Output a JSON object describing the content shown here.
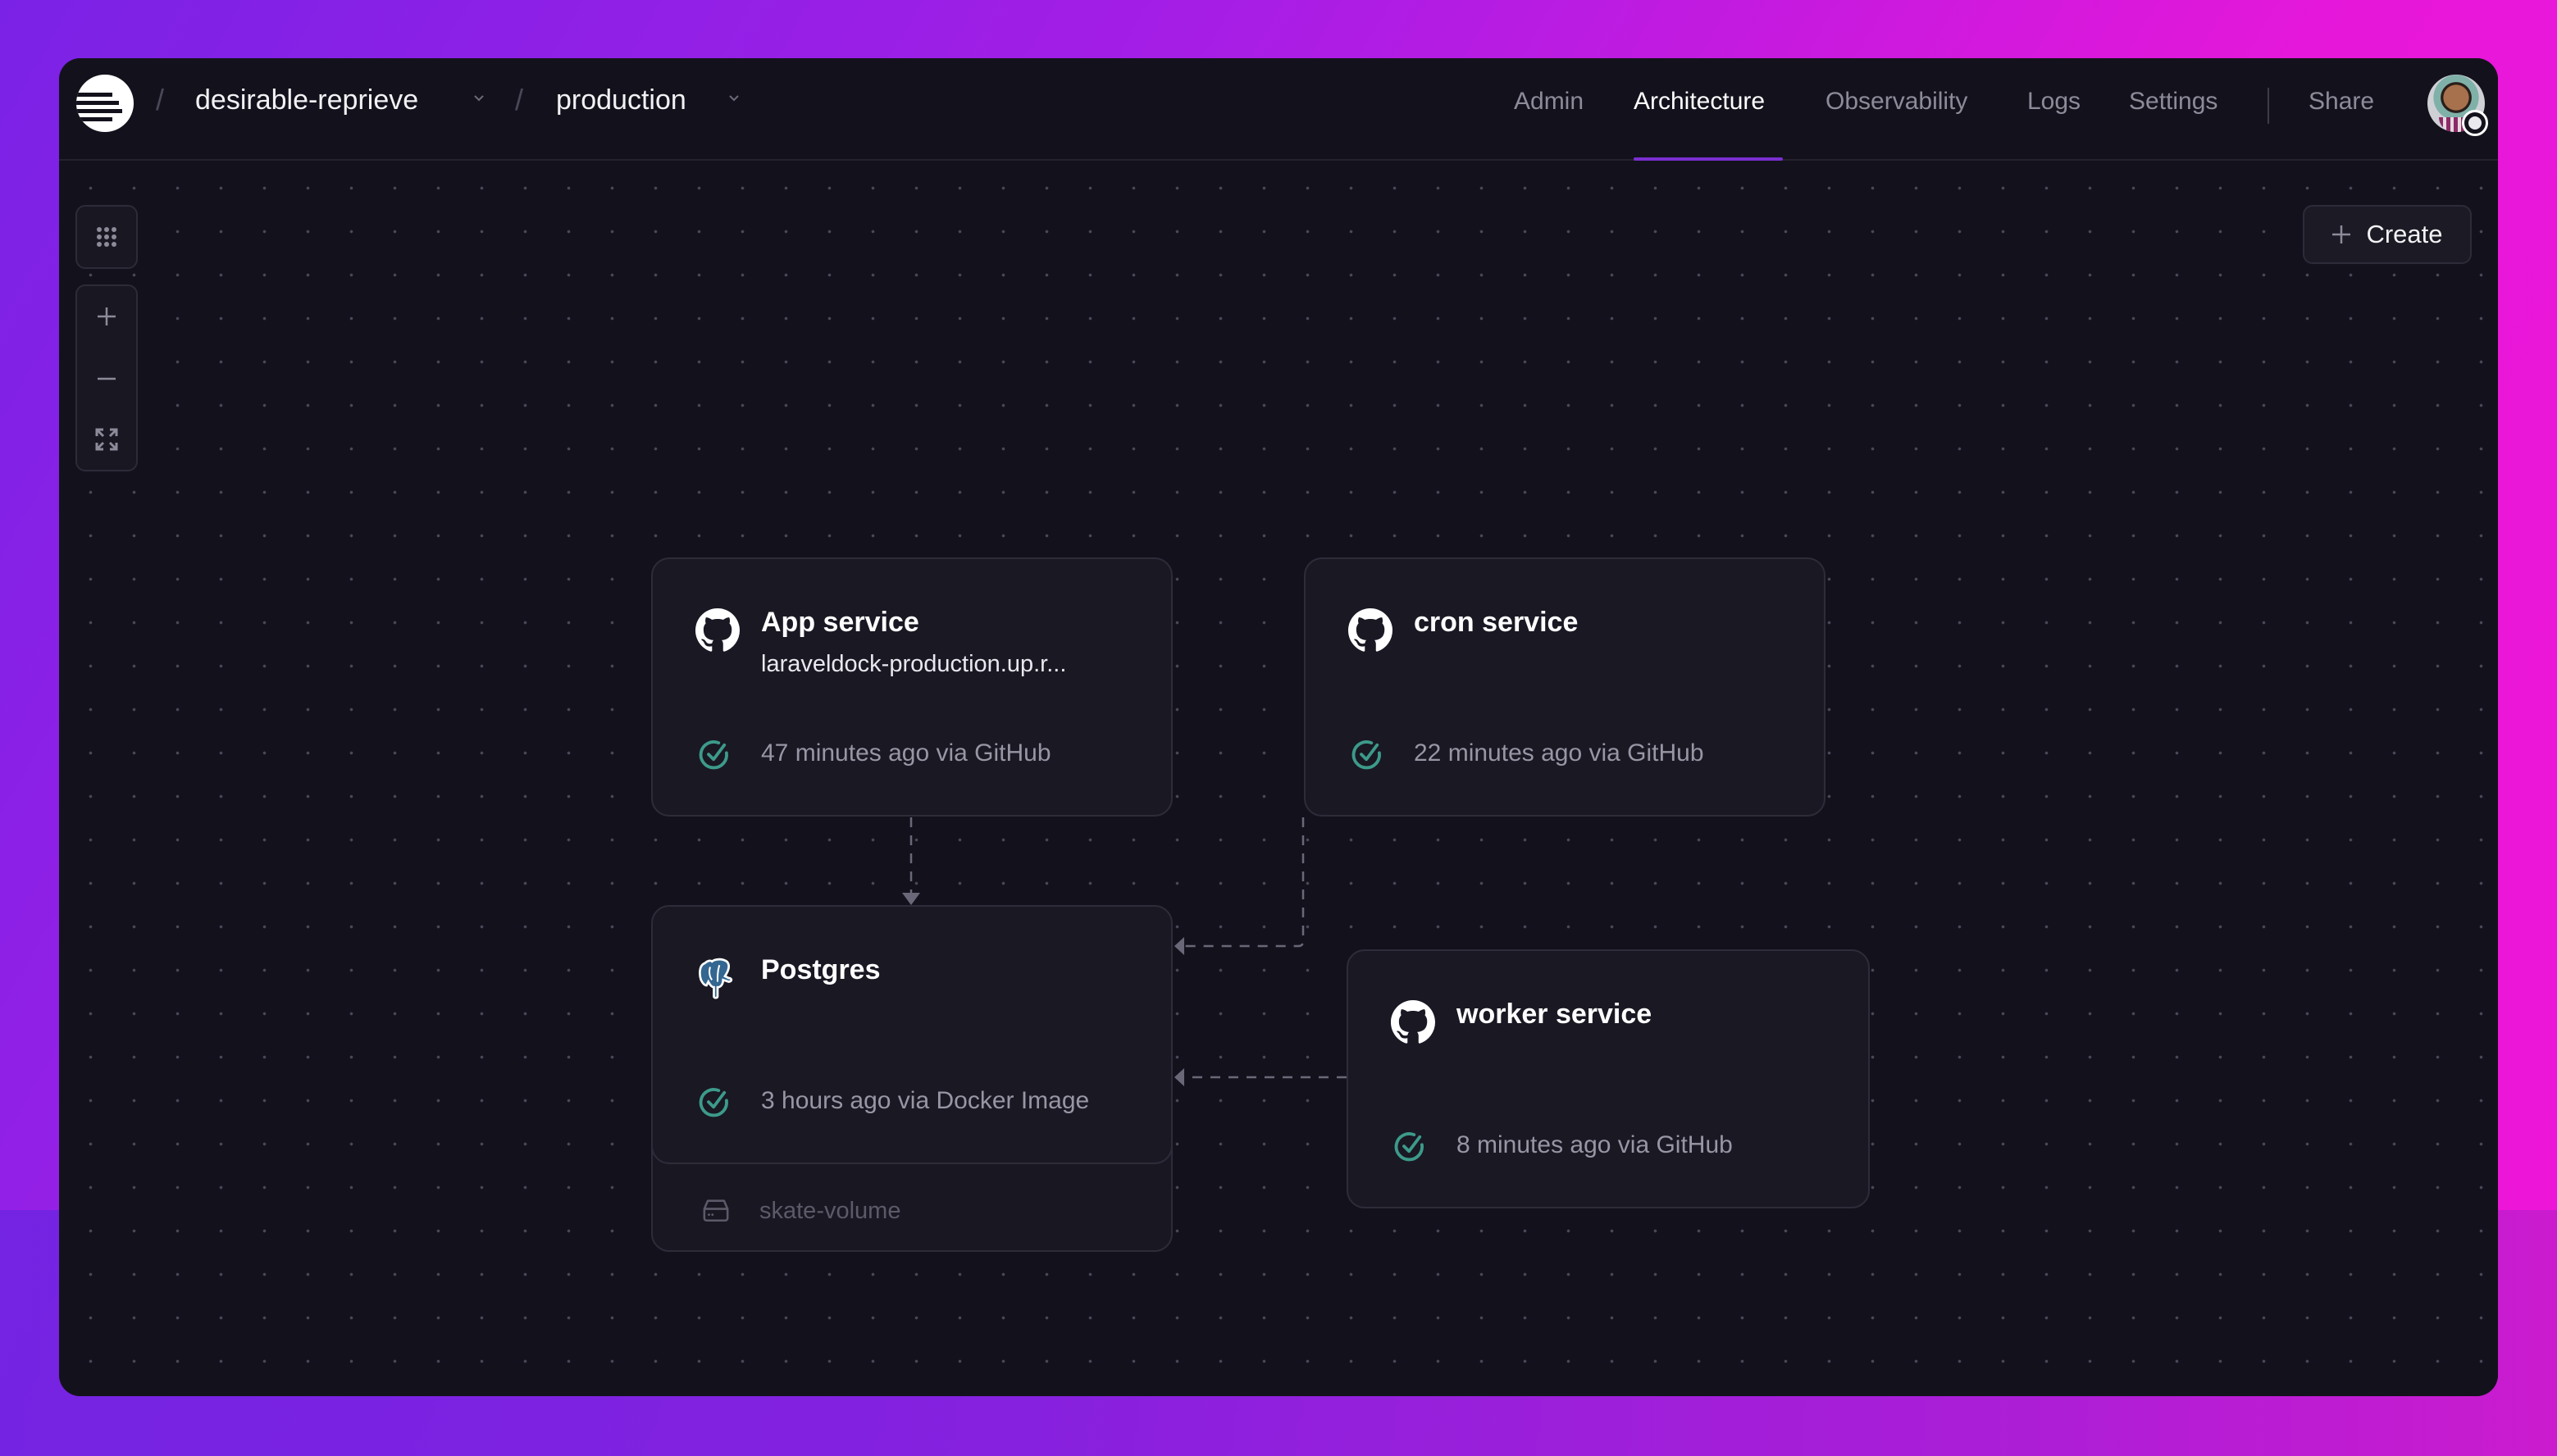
{
  "header": {
    "project": "desirable-reprieve",
    "environment": "production",
    "nav": [
      {
        "label": "Admin",
        "active": false
      },
      {
        "label": "Architecture",
        "active": true
      },
      {
        "label": "Observability",
        "active": false
      },
      {
        "label": "Logs",
        "active": false
      },
      {
        "label": "Settings",
        "active": false
      }
    ],
    "share_label": "Share",
    "accent": "#7b2fd0"
  },
  "toolbar": {
    "create_label": "Create",
    "controls": [
      "grid-icon",
      "zoom-in-icon",
      "zoom-out-icon",
      "fit-view-icon"
    ]
  },
  "services": [
    {
      "id": "app",
      "name": "App service",
      "domain": "laraveldock-production.up.r...",
      "status": "47 minutes ago via GitHub",
      "source": "github-icon"
    },
    {
      "id": "cron",
      "name": "cron service",
      "domain": "",
      "status": "22 minutes ago via GitHub",
      "source": "github-icon"
    },
    {
      "id": "postgres",
      "name": "Postgres",
      "domain": "",
      "status": "3 hours ago via Docker Image",
      "source": "postgres-icon",
      "volume": "skate-volume"
    },
    {
      "id": "worker",
      "name": "worker service",
      "domain": "",
      "status": "8 minutes ago via GitHub",
      "source": "github-icon"
    }
  ],
  "connections": [
    {
      "from": "App service",
      "to": "Postgres"
    },
    {
      "from": "cron service",
      "to": "Postgres"
    },
    {
      "from": "worker service",
      "to": "Postgres"
    }
  ],
  "colors": {
    "success": "#3d9a8a",
    "window_bg": "#13121c",
    "card_bg": "#191823"
  }
}
